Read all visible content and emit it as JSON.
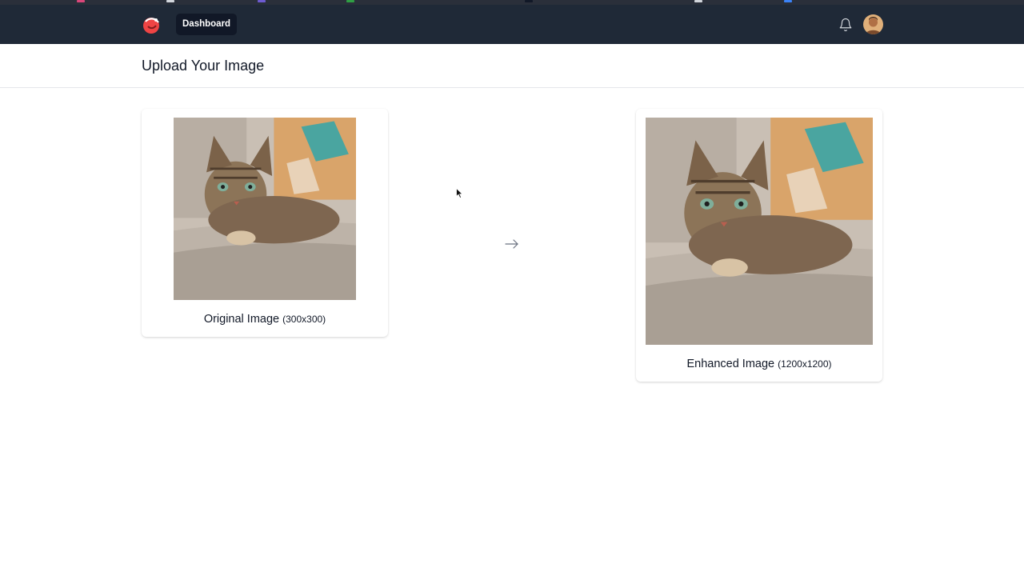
{
  "nav": {
    "dashboard_label": "Dashboard"
  },
  "header": {
    "title": "Upload Your Image"
  },
  "original": {
    "label": "Original Image",
    "dimensions": "(300x300)"
  },
  "enhanced": {
    "label": "Enhanced Image",
    "dimensions": "(1200x1200)"
  },
  "icons": {
    "logo": "app-logo-icon",
    "bell": "bell-icon",
    "arrow": "arrow-right-icon",
    "avatar": "user-avatar"
  },
  "colors": {
    "navbar": "#1f2937",
    "nav_button": "#111827",
    "logo_red": "#ef4444"
  }
}
